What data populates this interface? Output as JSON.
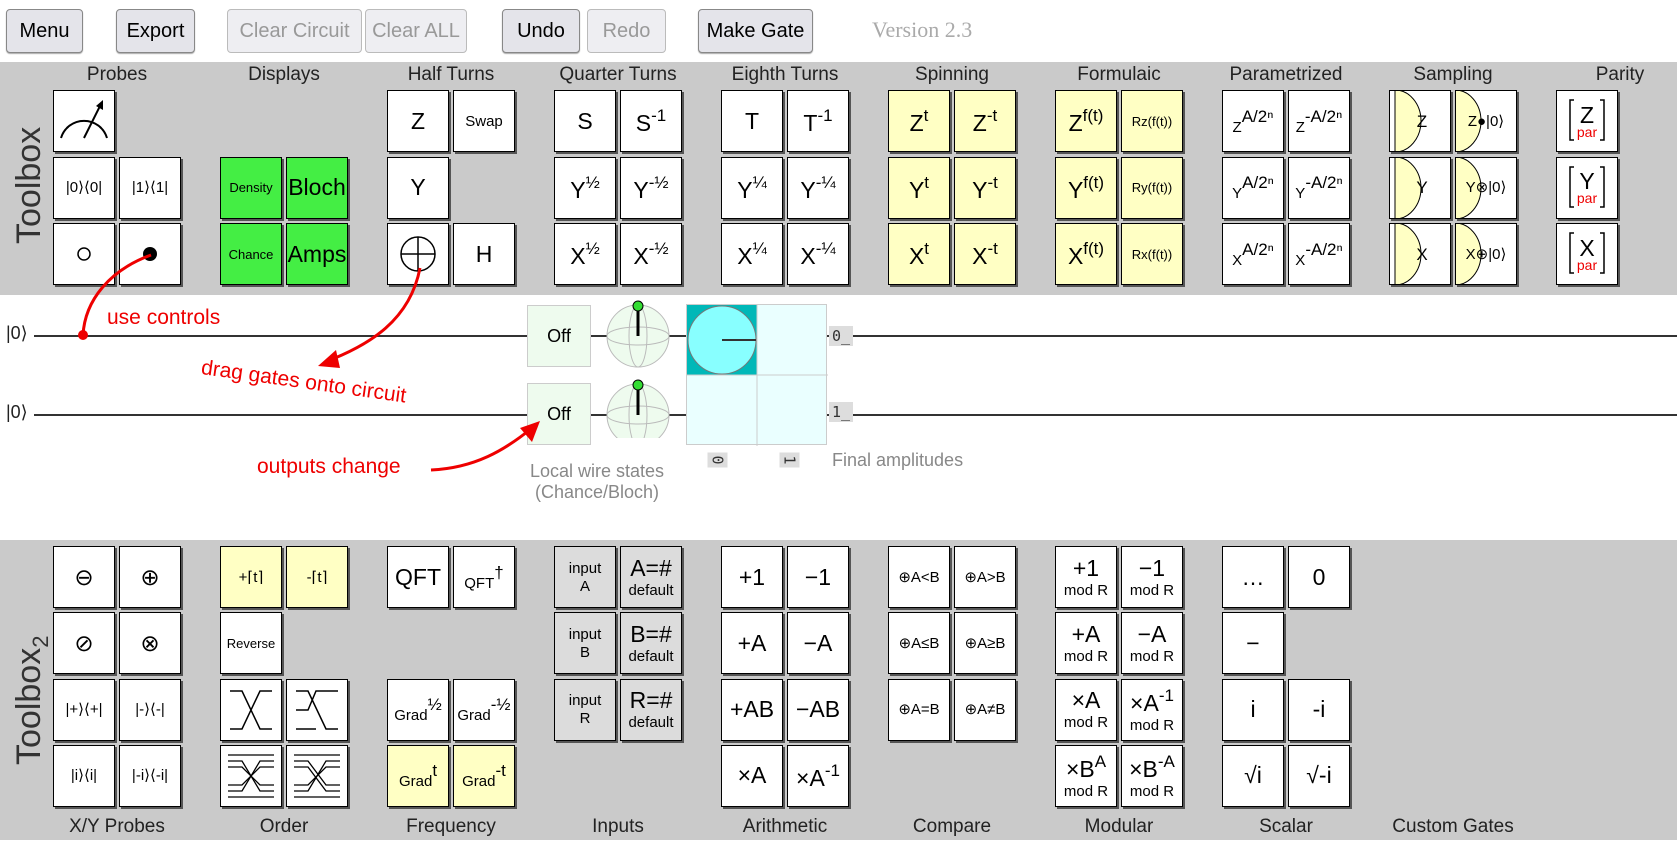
{
  "toolbar": {
    "menu": "Menu",
    "export": "Export",
    "clear_circuit": "Clear Circuit",
    "clear_all": "Clear ALL",
    "undo": "Undo",
    "redo": "Redo",
    "make_gate": "Make Gate",
    "version": "Version 2.3"
  },
  "colors": {
    "yellow": "#ffffc4",
    "green": "#44ee44",
    "input_gray": "#dcdcdc",
    "annotation_red": "#ee0000",
    "amp_cyan": "#88ffff",
    "amp_teal": "#00b8b8"
  },
  "toolbox1": {
    "title": "Toolbox",
    "groups": [
      {
        "label": "Probes",
        "rows": [
          [
            {
              "icon": "meter"
            },
            null
          ],
          [
            {
              "t": "|0⟩⟨0|",
              "cls": "small"
            },
            {
              "t": "|1⟩⟨1|",
              "cls": "small"
            }
          ],
          [
            {
              "icon": "anti-control"
            },
            {
              "icon": "control"
            }
          ]
        ]
      },
      {
        "label": "Displays",
        "rows": [
          [
            null,
            null
          ],
          [
            {
              "t": "Density",
              "bg": "green",
              "cls": "tiny"
            },
            {
              "t": "Bloch",
              "bg": "green"
            }
          ],
          [
            {
              "t": "Chance",
              "bg": "green",
              "cls": "tiny"
            },
            {
              "t": "Amps",
              "bg": "green"
            }
          ]
        ]
      },
      {
        "label": "Half Turns",
        "rows": [
          [
            {
              "t": "Z"
            },
            {
              "t": "Swap",
              "cls": "small"
            }
          ],
          [
            {
              "t": "Y"
            },
            null
          ],
          [
            {
              "icon": "oplus"
            },
            {
              "t": "H"
            }
          ]
        ]
      },
      {
        "label": "Quarter Turns",
        "rows": [
          [
            {
              "t": "S"
            },
            {
              "t": "S",
              "sup": "-1"
            }
          ],
          [
            {
              "t": "Y",
              "sup": "½"
            },
            {
              "t": "Y",
              "sup": "-½"
            }
          ],
          [
            {
              "t": "X",
              "sup": "½"
            },
            {
              "t": "X",
              "sup": "-½"
            }
          ]
        ]
      },
      {
        "label": "Eighth Turns",
        "rows": [
          [
            {
              "t": "T"
            },
            {
              "t": "T",
              "sup": "-1"
            }
          ],
          [
            {
              "t": "Y",
              "sup": "¼"
            },
            {
              "t": "Y",
              "sup": "-¼"
            }
          ],
          [
            {
              "t": "X",
              "sup": "¼"
            },
            {
              "t": "X",
              "sup": "-¼"
            }
          ]
        ]
      },
      {
        "label": "Spinning",
        "rows": [
          [
            {
              "t": "Z",
              "sup": "t",
              "bg": "yellow"
            },
            {
              "t": "Z",
              "sup": "-t",
              "bg": "yellow"
            }
          ],
          [
            {
              "t": "Y",
              "sup": "t",
              "bg": "yellow"
            },
            {
              "t": "Y",
              "sup": "-t",
              "bg": "yellow"
            }
          ],
          [
            {
              "t": "X",
              "sup": "t",
              "bg": "yellow"
            },
            {
              "t": "X",
              "sup": "-t",
              "bg": "yellow"
            }
          ]
        ]
      },
      {
        "label": "Formulaic",
        "rows": [
          [
            {
              "t": "Z",
              "sup": "f(t)",
              "bg": "yellow"
            },
            {
              "t": "Rz(f(t))",
              "bg": "yellow",
              "cls": "tiny"
            }
          ],
          [
            {
              "t": "Y",
              "sup": "f(t)",
              "bg": "yellow"
            },
            {
              "t": "Ry(f(t))",
              "bg": "yellow",
              "cls": "tiny"
            }
          ],
          [
            {
              "t": "X",
              "sup": "f(t)",
              "bg": "yellow"
            },
            {
              "t": "Rx(f(t))",
              "bg": "yellow",
              "cls": "tiny"
            }
          ]
        ]
      },
      {
        "label": "Parametrized",
        "rows": [
          [
            {
              "t": "Z",
              "sup": "A/2ⁿ",
              "cls": "small"
            },
            {
              "t": "Z",
              "sup": "-A/2ⁿ",
              "cls": "small"
            }
          ],
          [
            {
              "t": "Y",
              "sup": "A/2ⁿ",
              "cls": "small"
            },
            {
              "t": "Y",
              "sup": "-A/2ⁿ",
              "cls": "small"
            }
          ],
          [
            {
              "t": "X",
              "sup": "A/2ⁿ",
              "cls": "small"
            },
            {
              "t": "X",
              "sup": "-A/2ⁿ",
              "cls": "small"
            }
          ]
        ]
      },
      {
        "label": "Sampling",
        "rows": [
          [
            {
              "icon": "sample",
              "t": "Z"
            },
            {
              "icon": "sample-post",
              "t": "Z●|0⟩"
            }
          ],
          [
            {
              "icon": "sample",
              "t": "Y"
            },
            {
              "icon": "sample-post",
              "t": "Y⊗|0⟩"
            }
          ],
          [
            {
              "icon": "sample",
              "t": "X"
            },
            {
              "icon": "sample-post",
              "t": "X⊕|0⟩"
            }
          ]
        ]
      },
      {
        "label": "Parity",
        "rows": [
          [
            {
              "icon": "parity",
              "t": "Z",
              "sub": "par"
            }
          ],
          [
            {
              "icon": "parity",
              "t": "Y",
              "sub": "par"
            }
          ],
          [
            {
              "icon": "parity",
              "t": "X",
              "sub": "par"
            }
          ]
        ]
      }
    ]
  },
  "circuit": {
    "wires": [
      {
        "label": "|0⟩",
        "chance": "Off",
        "out_tag": "0_"
      },
      {
        "label": "|0⟩",
        "chance": "Off",
        "out_tag": "1_"
      }
    ],
    "amp_col_tags": [
      "0",
      "1"
    ],
    "amp_probability": 1,
    "local_states_caption_1": "Local wire states",
    "local_states_caption_2": "(Chance/Bloch)",
    "final_amplitudes": "Final amplitudes",
    "annotations": {
      "controls": "use controls",
      "drag": "drag gates onto circuit",
      "outputs": "outputs change"
    }
  },
  "toolbox2": {
    "title": "Toolbox",
    "title_sub": "2",
    "groups": [
      {
        "label": "X/Y Probes",
        "rows": [
          [
            {
              "t": "⊖"
            },
            {
              "t": "⊕"
            }
          ],
          [
            {
              "t": "⊘"
            },
            {
              "t": "⊗"
            }
          ],
          [
            {
              "t": "|+⟩⟨+|",
              "cls": "small"
            },
            {
              "t": "|-⟩⟨-|",
              "cls": "small"
            }
          ],
          [
            {
              "t": "|i⟩⟨i|",
              "cls": "small"
            },
            {
              "t": "|-i⟩⟨-i|",
              "cls": "small"
            }
          ]
        ]
      },
      {
        "label": "Order",
        "rows": [
          [
            {
              "t": "+⌈t⌉",
              "bg": "yellow",
              "cls": "small"
            },
            {
              "t": "-⌈t⌉",
              "bg": "yellow",
              "cls": "small"
            }
          ],
          [
            {
              "t": "Reverse",
              "cls": "tiny"
            },
            null
          ],
          [
            {
              "icon": "cycle-up"
            },
            {
              "icon": "cycle-down"
            }
          ],
          [
            {
              "icon": "interleave"
            },
            {
              "icon": "deinterleave"
            }
          ]
        ]
      },
      {
        "label": "Frequency",
        "rows": [
          [
            {
              "t": "QFT"
            },
            {
              "t": "QFT",
              "sup": "†",
              "cls": "small"
            }
          ],
          [
            null,
            null
          ],
          [
            {
              "t": "Grad",
              "sup": "½",
              "cls": "small"
            },
            {
              "t": "Grad",
              "sup": "-½",
              "cls": "small"
            }
          ],
          [
            {
              "t": "Grad",
              "sup": "t",
              "bg": "yellow",
              "cls": "small"
            },
            {
              "t": "Grad",
              "sup": "-t",
              "bg": "yellow",
              "cls": "small"
            }
          ]
        ]
      },
      {
        "label": "Inputs",
        "rows": [
          [
            {
              "t": "input",
              "s": "A",
              "bg": "gray",
              "cls": "small"
            },
            {
              "t": "A=#",
              "s": "default",
              "bg": "gray"
            }
          ],
          [
            {
              "t": "input",
              "s": "B",
              "bg": "gray",
              "cls": "small"
            },
            {
              "t": "B=#",
              "s": "default",
              "bg": "gray"
            }
          ],
          [
            {
              "t": "input",
              "s": "R",
              "bg": "gray",
              "cls": "small"
            },
            {
              "t": "R=#",
              "s": "default",
              "bg": "gray"
            }
          ]
        ]
      },
      {
        "label": "Arithmetic",
        "rows": [
          [
            {
              "t": "+1"
            },
            {
              "t": "−1"
            }
          ],
          [
            {
              "t": "+A"
            },
            {
              "t": "−A"
            }
          ],
          [
            {
              "t": "+AB"
            },
            {
              "t": "−AB"
            }
          ],
          [
            {
              "t": "×A"
            },
            {
              "t": "×A",
              "sup": "-1"
            }
          ]
        ]
      },
      {
        "label": "Compare",
        "rows": [
          [
            {
              "t": "⊕A<B",
              "cls": "small"
            },
            {
              "t": "⊕A>B",
              "cls": "small"
            }
          ],
          [
            {
              "t": "⊕A≤B",
              "cls": "small"
            },
            {
              "t": "⊕A≥B",
              "cls": "small"
            }
          ],
          [
            {
              "t": "⊕A=B",
              "cls": "small"
            },
            {
              "t": "⊕A≠B",
              "cls": "small"
            }
          ]
        ]
      },
      {
        "label": "Modular",
        "rows": [
          [
            {
              "t": "+1",
              "s": "mod R"
            },
            {
              "t": "−1",
              "s": "mod R"
            }
          ],
          [
            {
              "t": "+A",
              "s": "mod R"
            },
            {
              "t": "−A",
              "s": "mod R"
            }
          ],
          [
            {
              "t": "×A",
              "s": "mod R"
            },
            {
              "t": "×A",
              "sup": "-1",
              "s": "mod R"
            }
          ],
          [
            {
              "t": "×B",
              "sup": "A",
              "s": "mod R"
            },
            {
              "t": "×B",
              "sup": "-A",
              "s": "mod R"
            }
          ]
        ]
      },
      {
        "label": "Scalar",
        "rows": [
          [
            {
              "t": "…"
            },
            {
              "t": "0"
            }
          ],
          [
            {
              "t": "−"
            },
            null
          ],
          [
            {
              "t": "i"
            },
            {
              "t": "-i"
            }
          ],
          [
            {
              "t": "√i"
            },
            {
              "t": "√-i"
            }
          ]
        ]
      },
      {
        "label": "Custom Gates",
        "rows": []
      }
    ]
  }
}
